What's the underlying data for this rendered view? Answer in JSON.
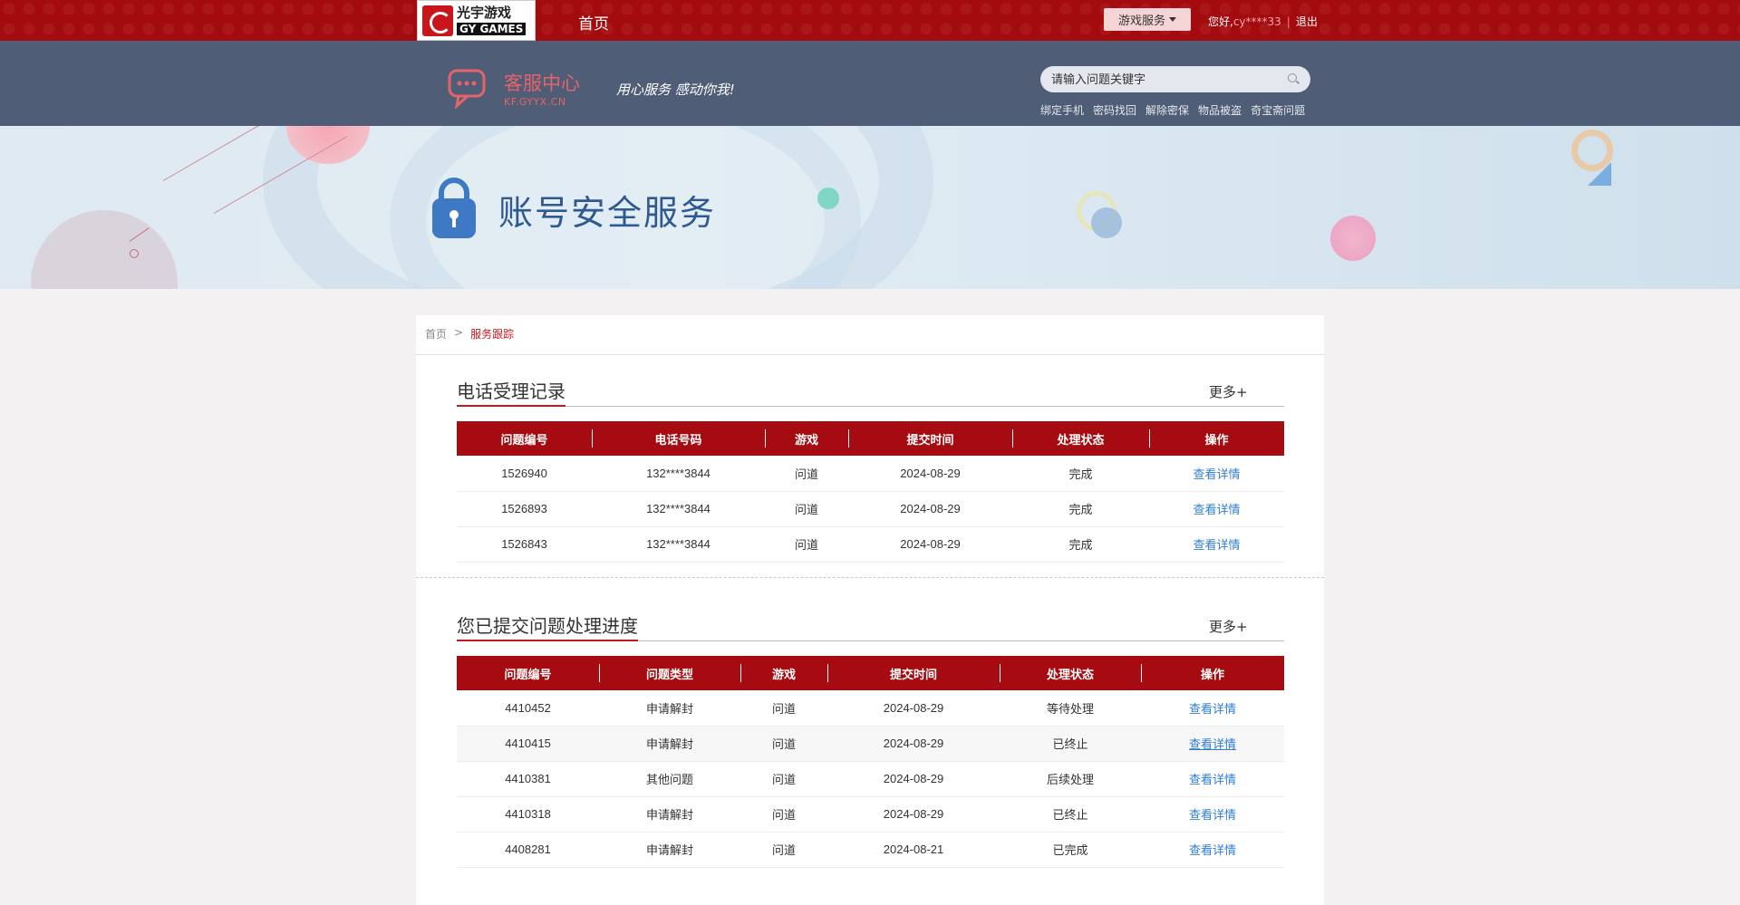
{
  "topbar": {
    "logo_cn": "光宇游戏",
    "logo_en": "GY GAMES",
    "home": "首页",
    "game_service": "游戏服务",
    "greeting": "您好,",
    "username": "cy****33",
    "separator": "|",
    "logout": "退出"
  },
  "service": {
    "title": "客服中心",
    "domain": "KF.GYYX.CN",
    "slogan": "用心服务 感动你我!",
    "search_placeholder": "请输入问题关键字",
    "quick_links": [
      "绑定手机",
      "密码找回",
      "解除密保",
      "物品被盗",
      "奇宝斋问题"
    ]
  },
  "banner": {
    "title": "账号安全服务"
  },
  "breadcrumb": {
    "home": "首页",
    "sep": ">",
    "current": "服务跟踪"
  },
  "phone_records": {
    "title": "电话受理记录",
    "more": "更多+",
    "columns": [
      "问题编号",
      "电话号码",
      "游戏",
      "提交时间",
      "处理状态",
      "操作"
    ],
    "rows": [
      [
        "1526940",
        "132****3844",
        "问道",
        "2024-08-29",
        "完成",
        "查看详情"
      ],
      [
        "1526893",
        "132****3844",
        "问道",
        "2024-08-29",
        "完成",
        "查看详情"
      ],
      [
        "1526843",
        "132****3844",
        "问道",
        "2024-08-29",
        "完成",
        "查看详情"
      ]
    ]
  },
  "submitted": {
    "title": "您已提交问题处理进度",
    "more": "更多+",
    "columns": [
      "问题编号",
      "问题类型",
      "游戏",
      "提交时间",
      "处理状态",
      "操作"
    ],
    "rows": [
      [
        "4410452",
        "申请解封",
        "问道",
        "2024-08-29",
        "等待处理",
        "查看详情"
      ],
      [
        "4410415",
        "申请解封",
        "问道",
        "2024-08-29",
        "已终止",
        "查看详情"
      ],
      [
        "4410381",
        "其他问题",
        "问道",
        "2024-08-29",
        "后续处理",
        "查看详情"
      ],
      [
        "4410318",
        "申请解封",
        "问道",
        "2024-08-29",
        "已终止",
        "查看详情"
      ],
      [
        "4408281",
        "申请解封",
        "问道",
        "2024-08-21",
        "已完成",
        "查看详情"
      ]
    ]
  },
  "colors": {
    "brand_red": "#a50b10",
    "header_slate": "#4f5d77",
    "link_blue": "#2e7ed6",
    "title_blue": "#2e5a91"
  }
}
